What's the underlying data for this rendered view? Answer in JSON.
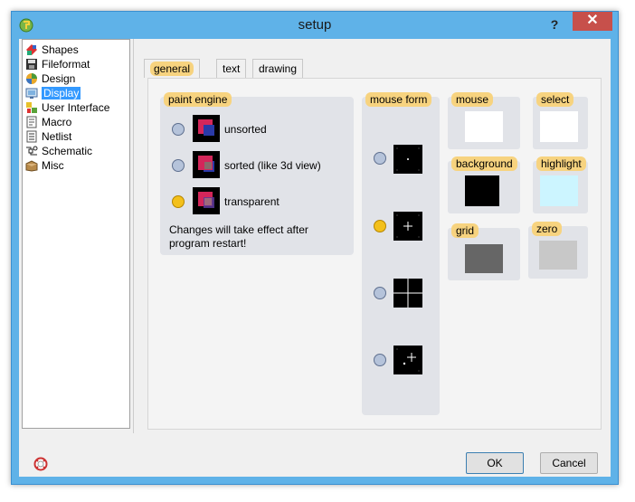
{
  "window": {
    "title": "setup",
    "help_glyph": "?",
    "close_glyph": "✕"
  },
  "tree": {
    "items": [
      {
        "label": "Shapes",
        "icon": "shapes-icon"
      },
      {
        "label": "Fileformat",
        "icon": "fileformat-icon"
      },
      {
        "label": "Design",
        "icon": "design-icon"
      },
      {
        "label": "Display",
        "icon": "display-icon",
        "selected": true
      },
      {
        "label": "User Interface",
        "icon": "user-interface-icon"
      },
      {
        "label": "Macro",
        "icon": "macro-icon"
      },
      {
        "label": "Netlist",
        "icon": "netlist-icon"
      },
      {
        "label": "Schematic",
        "icon": "schematic-icon"
      },
      {
        "label": "Misc",
        "icon": "misc-icon"
      }
    ]
  },
  "tabs": [
    {
      "label": "general",
      "active": true
    },
    {
      "label": "text",
      "active": false
    },
    {
      "label": "drawing",
      "active": false
    }
  ],
  "paint_engine": {
    "title": "paint engine",
    "options": [
      {
        "label": "unsorted",
        "selected": false
      },
      {
        "label": "sorted (like 3d view)",
        "selected": false
      },
      {
        "label": "transparent",
        "selected": true
      }
    ],
    "note": "Changes will take effect after program restart!"
  },
  "mouse_form": {
    "title": "mouse form",
    "options": [
      {
        "icon": "dot-cursor-icon",
        "selected": false
      },
      {
        "icon": "small-cross-cursor-icon",
        "selected": true
      },
      {
        "icon": "full-cross-cursor-icon",
        "selected": false
      },
      {
        "icon": "cross-sparkle-cursor-icon",
        "selected": false
      }
    ]
  },
  "colors": {
    "mouse": {
      "label": "mouse",
      "color": "#ffffff"
    },
    "select": {
      "label": "select",
      "color": "#ffffff"
    },
    "background": {
      "label": "background",
      "color": "#000000"
    },
    "highlight": {
      "label": "highlight",
      "color": "#ccf5ff"
    },
    "grid": {
      "label": "grid",
      "color": "#666666"
    },
    "zero": {
      "label": "zero",
      "color": "#c8c8c8"
    }
  },
  "buttons": {
    "ok": "OK",
    "cancel": "Cancel"
  }
}
